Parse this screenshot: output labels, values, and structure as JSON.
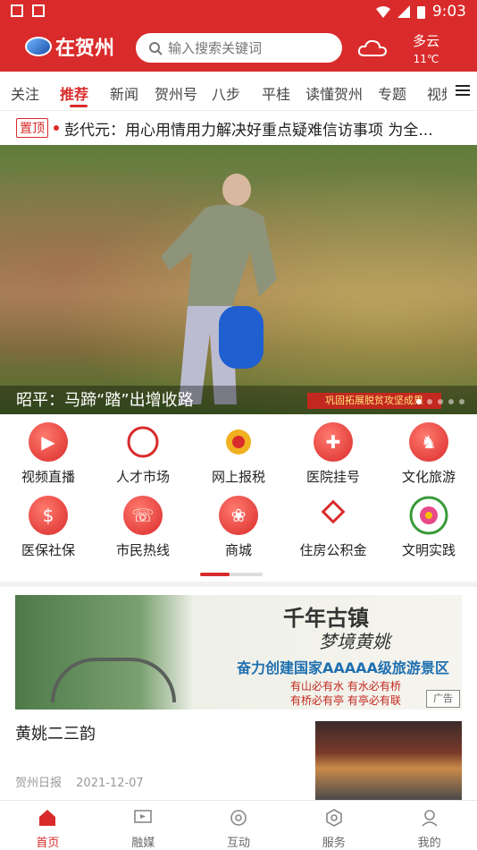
{
  "status": {
    "time": "9:03"
  },
  "header": {
    "app_name": "在贺州",
    "search_placeholder": "输入搜索关键词",
    "weather": {
      "condition": "多云",
      "temp": "11℃"
    }
  },
  "tabs": [
    "关注",
    "推荐",
    "新闻",
    "贺州号",
    "八步",
    "平桂",
    "读懂贺州",
    "专题",
    "视频"
  ],
  "active_tab": "推荐",
  "headline": {
    "tag": "置顶",
    "text": "彭代元：用心用情用力解决好重点疑难信访事项 为全..."
  },
  "hero": {
    "caption": "昭平：马蹄“踏”出增收路",
    "banner": "巩固拓展脱贫攻坚成果"
  },
  "services": [
    {
      "label": "视频直播"
    },
    {
      "label": "人才市场"
    },
    {
      "label": "网上报税"
    },
    {
      "label": "医院挂号"
    },
    {
      "label": "文化旅游"
    },
    {
      "label": "医保社保"
    },
    {
      "label": "市民热线"
    },
    {
      "label": "商城"
    },
    {
      "label": "住房公积金"
    },
    {
      "label": "文明实践"
    }
  ],
  "ad": {
    "line1": "千年古镇",
    "line2": "梦境黄姚",
    "line3": "奋力创建国家AAAAA级旅游景区",
    "line4": "有山必有水 有水必有桥",
    "line5": "有桥必有亭 有亭必有联",
    "tag": "广告"
  },
  "news": {
    "title": "黄姚二三韵",
    "source": "贺州日报",
    "date": "2021-12-07"
  },
  "bottom_nav": [
    "首页",
    "融媒",
    "互动",
    "服务",
    "我的"
  ],
  "colors": {
    "brand": "#d92b2b"
  }
}
